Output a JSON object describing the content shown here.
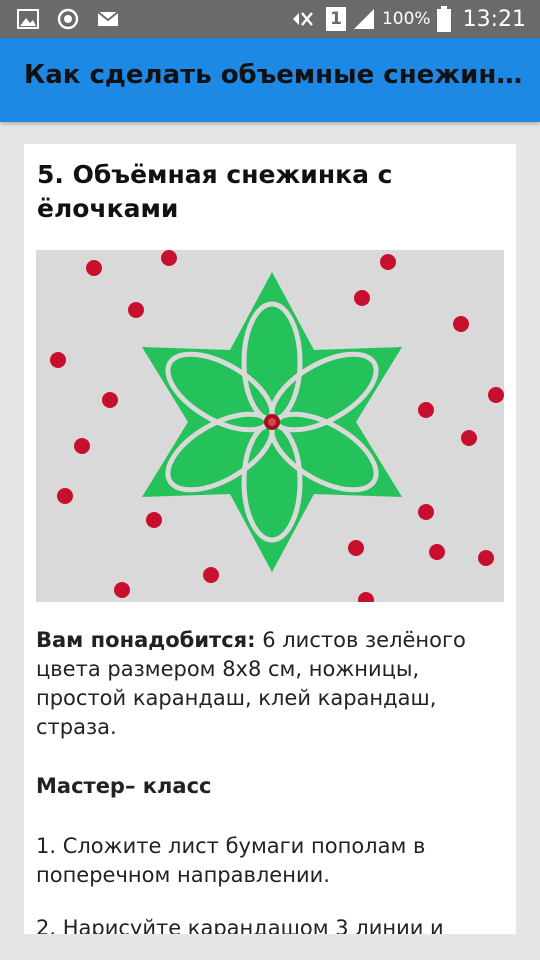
{
  "status_bar": {
    "battery_percent": "100%",
    "time": "13:21",
    "sim_slot": "1",
    "icons": [
      "image-icon",
      "sync-icon",
      "mail-icon",
      "mute-icon",
      "sim-icon",
      "signal-icon",
      "battery-icon"
    ]
  },
  "app_bar": {
    "title": "Как сделать объемные снежин…",
    "color": "#1e88e5"
  },
  "article": {
    "heading": "5. Объёмная снежинка с ёлочками",
    "image_alt": "green-paper-snowflake-photo",
    "needs_label": "Вам понадобится:",
    "needs_text": " 6 листов зелёного цвета размером 8х8 см, ножницы, простой карандаш, клей карандаш, страза.",
    "master_class": "Мастер– класс",
    "step1": "1. Сложите лист бумаги пополам в поперечном направлении.",
    "step2": "2. Нарисуйте карандашом 3 линии и"
  },
  "colors": {
    "paper_green": "#25c15a",
    "berry_red": "#c8102e"
  }
}
